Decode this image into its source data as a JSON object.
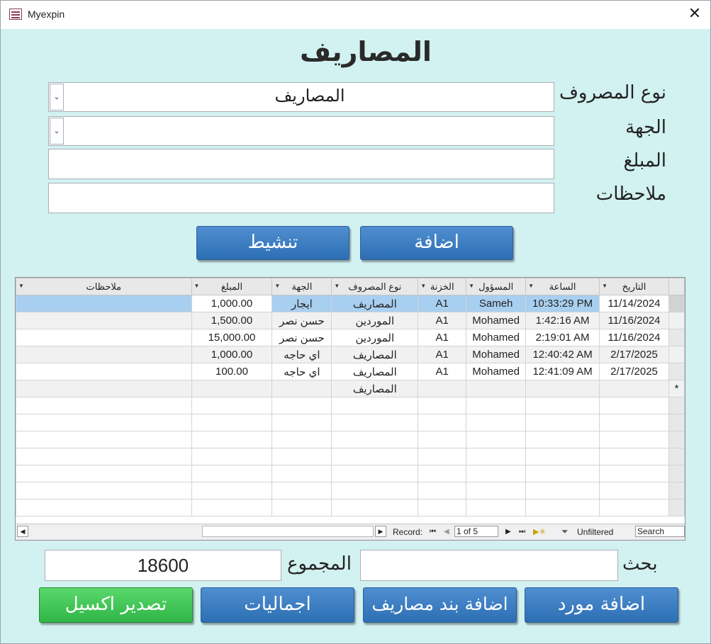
{
  "window": {
    "title": "Myexpin",
    "close_glyph": "✕"
  },
  "form": {
    "title": "المصاريف",
    "labels": {
      "expense_type": "نوع المصروف",
      "party": "الجهة",
      "amount": "المبلغ",
      "notes": "ملاحظات"
    },
    "values": {
      "expense_type": "المصاريف",
      "party": "",
      "amount": "",
      "notes": ""
    },
    "buttons": {
      "refresh": "تنشيط",
      "add": "اضافة"
    }
  },
  "table": {
    "columns": [
      "التاريخ",
      "الساعة",
      "المسؤول",
      "الخزنة",
      "نوع المصروف",
      "الجهة",
      "المبلغ",
      "ملاحظات"
    ],
    "rows": [
      [
        "11/14/2024",
        "10:33:29 PM",
        "Sameh",
        "A1",
        "المصاريف",
        "ايجار",
        "1,000.00",
        ""
      ],
      [
        "11/16/2024",
        "1:42:16 AM",
        "Mohamed",
        "A1",
        "الموردين",
        "حسن نصر",
        "1,500.00",
        ""
      ],
      [
        "11/16/2024",
        "2:19:01 AM",
        "Mohamed",
        "A1",
        "الموردين",
        "حسن نصر",
        "15,000.00",
        ""
      ],
      [
        "2/17/2025",
        "12:40:42 AM",
        "Mohamed",
        "A1",
        "المصاريف",
        "اي حاجه",
        "1,000.00",
        ""
      ],
      [
        "2/17/2025",
        "12:41:09 AM",
        "Mohamed",
        "A1",
        "المصاريف",
        "اي حاجه",
        "100.00",
        ""
      ]
    ],
    "new_row": {
      "marker": "*",
      "expense_type": "المصاريف"
    },
    "navigation": {
      "record_label": "Record:",
      "position": "1 of 5",
      "filter": "Unfiltered",
      "search_placeholder": "Search"
    }
  },
  "footer": {
    "search_label": "بحث",
    "total_label": "المجموع",
    "total_value": "18600",
    "buttons": {
      "add_supplier": "اضافة مورد",
      "add_expense_item": "اضافة بند مصاريف",
      "totals": "اجماليات",
      "export_excel": "تصدير اكسيل"
    }
  },
  "colors": {
    "background": "#d2f1f1",
    "blue_button": "#3b7ec4",
    "green_button": "#3cc653",
    "selected_row": "#a9cff0"
  }
}
